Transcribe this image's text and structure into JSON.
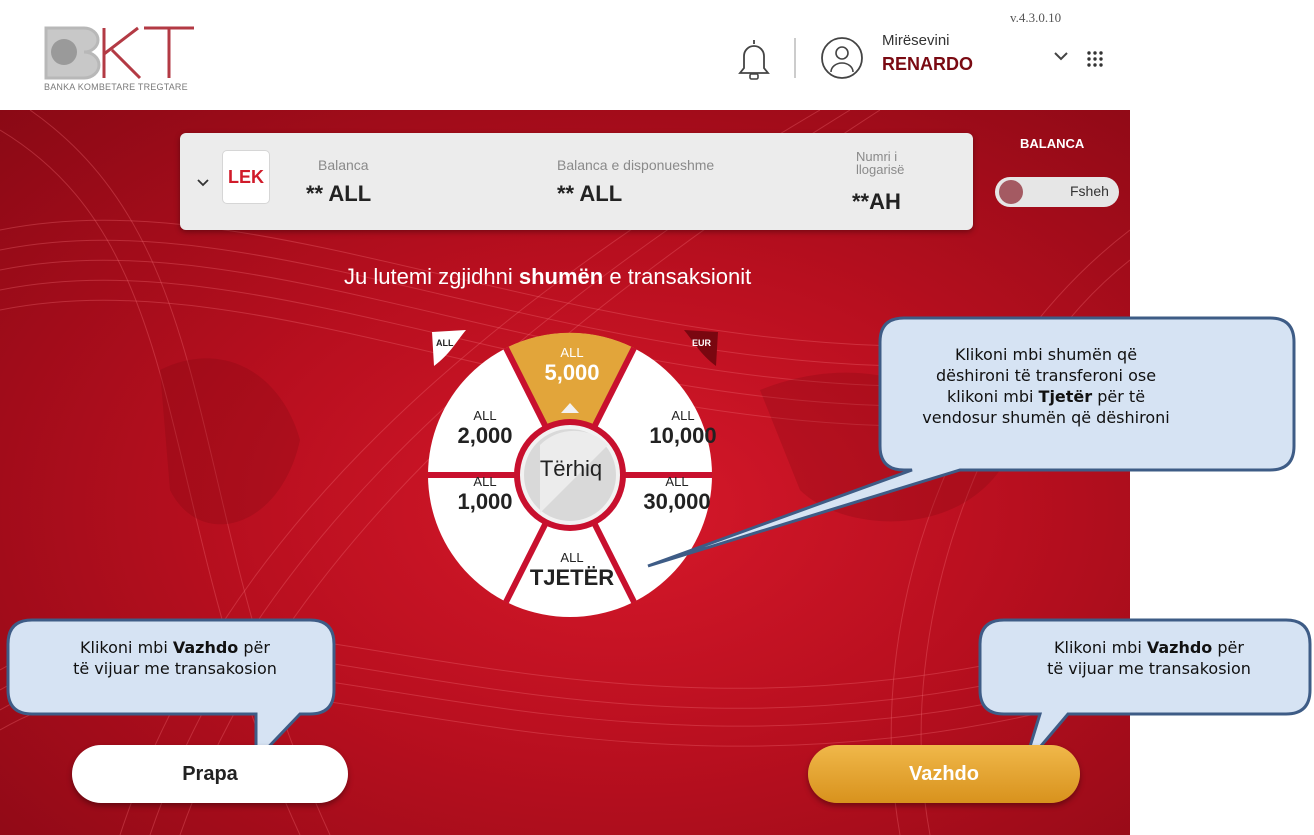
{
  "header": {
    "logo_sub": "BANKA KOMBETARE TREGTARE",
    "version": "v.4.3.0.10",
    "welcome": "Mirësevini",
    "username": "RENARDO"
  },
  "account": {
    "currency_code": "LEK",
    "balance_label": "Balanca",
    "balance_value": "** ALL",
    "available_label": "Balanca e disponueshme",
    "available_value": "** ALL",
    "account_label": "Numri i llogarisë",
    "account_value": "**AH"
  },
  "balance_toggle": {
    "title": "BALANCA",
    "state_label": "Fsheh"
  },
  "prompt": {
    "part1": "Ju lutemi ",
    "part2": "zgjidhni ",
    "part3": "shumën",
    "part4": " e transaksionit"
  },
  "wheel": {
    "tag_left": "ALL",
    "tag_right": "EUR",
    "center_label": "Tërhiq",
    "segments": [
      {
        "currency": "ALL",
        "amount": "5,000"
      },
      {
        "currency": "ALL",
        "amount": "2,000"
      },
      {
        "currency": "ALL",
        "amount": "10,000"
      },
      {
        "currency": "ALL",
        "amount": "1,000"
      },
      {
        "currency": "ALL",
        "amount": "30,000"
      },
      {
        "currency": "ALL",
        "amount": "TJETËR"
      }
    ]
  },
  "callouts": {
    "middle": {
      "l1": "Klikoni mbi shumën që",
      "l2": "dëshironi të transferoni ose",
      "l3a": "klikoni mbi ",
      "l3b": "Tjetër",
      "l3c": " për të",
      "l4": "vendosur shumën që dëshironi"
    },
    "left": {
      "l1a": "Klikoni mbi ",
      "l1b": "Vazhdo",
      "l1c": " për",
      "l2": "të vijuar me transakosion"
    },
    "right": {
      "l1a": "Klikoni mbi ",
      "l1b": "Vazhdo",
      "l1c": " për",
      "l2": "të vijuar me transakosion"
    }
  },
  "buttons": {
    "back": "Prapa",
    "next": "Vazhdo"
  },
  "colors": {
    "brand_red": "#c8102e",
    "accent_gold": "#e2a53a",
    "callout_fill": "#d6e3f3",
    "callout_border": "#3e5c86"
  }
}
